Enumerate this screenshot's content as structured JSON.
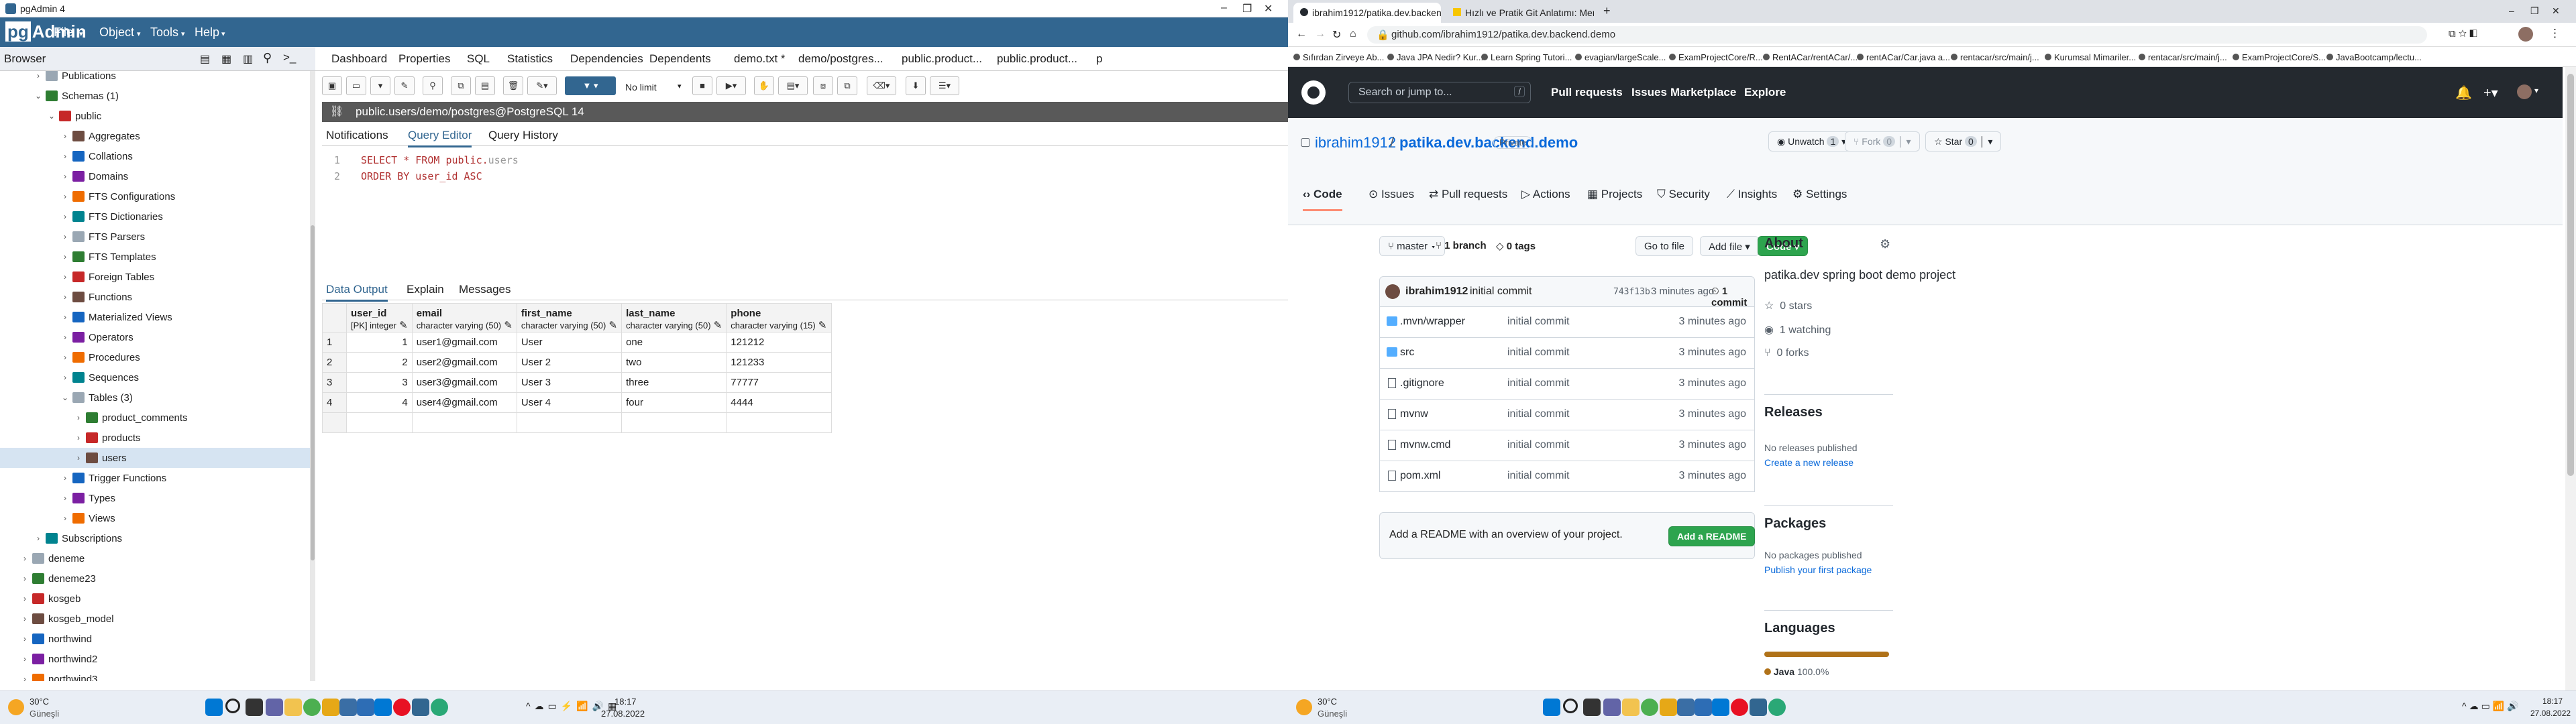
{
  "pgadmin": {
    "title": "pgAdmin 4",
    "menu": [
      "File",
      "Object",
      "Tools",
      "Help"
    ],
    "browser_label": "Browser",
    "tree": [
      {
        "label": "Publications",
        "depth": 3,
        "caret": ">"
      },
      {
        "label": "Schemas (1)",
        "depth": 3,
        "caret": "v"
      },
      {
        "label": "public",
        "depth": 4,
        "caret": "v"
      },
      {
        "label": "Aggregates",
        "depth": 5,
        "caret": ">"
      },
      {
        "label": "Collations",
        "depth": 5,
        "caret": ">"
      },
      {
        "label": "Domains",
        "depth": 5,
        "caret": ">"
      },
      {
        "label": "FTS Configurations",
        "depth": 5,
        "caret": ">"
      },
      {
        "label": "FTS Dictionaries",
        "depth": 5,
        "caret": ">"
      },
      {
        "label": "FTS Parsers",
        "depth": 5,
        "caret": ">"
      },
      {
        "label": "FTS Templates",
        "depth": 5,
        "caret": ">"
      },
      {
        "label": "Foreign Tables",
        "depth": 5,
        "caret": ">"
      },
      {
        "label": "Functions",
        "depth": 5,
        "caret": ">"
      },
      {
        "label": "Materialized Views",
        "depth": 5,
        "caret": ">"
      },
      {
        "label": "Operators",
        "depth": 5,
        "caret": ">"
      },
      {
        "label": "Procedures",
        "depth": 5,
        "caret": ">"
      },
      {
        "label": "Sequences",
        "depth": 5,
        "caret": ">"
      },
      {
        "label": "Tables (3)",
        "depth": 5,
        "caret": "v"
      },
      {
        "label": "product_comments",
        "depth": 6,
        "caret": ">"
      },
      {
        "label": "products",
        "depth": 6,
        "caret": ">"
      },
      {
        "label": "users",
        "depth": 6,
        "caret": ">",
        "selected": true
      },
      {
        "label": "Trigger Functions",
        "depth": 5,
        "caret": ">"
      },
      {
        "label": "Types",
        "depth": 5,
        "caret": ">"
      },
      {
        "label": "Views",
        "depth": 5,
        "caret": ">"
      },
      {
        "label": "Subscriptions",
        "depth": 3,
        "caret": ">"
      },
      {
        "label": "deneme",
        "depth": 2,
        "caret": ">"
      },
      {
        "label": "deneme23",
        "depth": 2,
        "caret": ">"
      },
      {
        "label": "kosgeb",
        "depth": 2,
        "caret": ">"
      },
      {
        "label": "kosgeb_model",
        "depth": 2,
        "caret": ">"
      },
      {
        "label": "northwind",
        "depth": 2,
        "caret": ">"
      },
      {
        "label": "northwind2",
        "depth": 2,
        "caret": ">"
      },
      {
        "label": "northwind3",
        "depth": 2,
        "caret": ">"
      }
    ],
    "tabs": [
      "Dashboard",
      "Properties",
      "SQL",
      "Statistics",
      "Dependencies",
      "Dependents",
      "demo.txt *",
      "demo/postgres...",
      "public.product...",
      "public.product...",
      "p"
    ],
    "limit_label": "No limit",
    "breadcrumb": "public.users/demo/postgres@PostgreSQL 14",
    "editor_tabs": [
      "Notifications",
      "Query Editor",
      "Query History"
    ],
    "sql": {
      "line1_kw": "SELECT * FROM",
      "line1_schema": "public.",
      "line1_table": "users",
      "line2": "ORDER BY user_id ASC"
    },
    "output_tabs": [
      "Data Output",
      "Explain",
      "Messages"
    ],
    "columns": [
      {
        "name": "user_id",
        "type": "[PK] integer"
      },
      {
        "name": "email",
        "type": "character varying (50)"
      },
      {
        "name": "first_name",
        "type": "character varying (50)"
      },
      {
        "name": "last_name",
        "type": "character varying (50)"
      },
      {
        "name": "phone",
        "type": "character varying (15)"
      }
    ],
    "rows": [
      [
        "1",
        "1",
        "user1@gmail.com",
        "User",
        "one",
        "121212"
      ],
      [
        "2",
        "2",
        "user2@gmail.com",
        "User 2",
        "two",
        "121233"
      ],
      [
        "3",
        "3",
        "user3@gmail.com",
        "User 3",
        "three",
        "77777"
      ],
      [
        "4",
        "4",
        "user4@gmail.com",
        "User 4",
        "four",
        "4444"
      ]
    ]
  },
  "taskbar_left": {
    "weather_temp": "30°C",
    "weather_desc": "Güneşli",
    "time": "18:17",
    "date": "27.08.2022"
  },
  "taskbar_right": {
    "weather_temp": "30°C",
    "weather_desc": "Güneşli",
    "time": "18:17",
    "date": "27.08.2022"
  },
  "chrome": {
    "tabs": [
      "ibrahim1912/patika.dev.backend...",
      "Hızlı ve Pratik Git Anlatımı: Merk...",
      "+"
    ],
    "url": "github.com/ibrahim1912/patika.dev.backend.demo",
    "bookmarks": [
      "Sıfırdan Zirveye Ab...",
      "Java JPA Nedir? Kur...",
      "Learn Spring Tutori...",
      "evagian/largeScale...",
      "ExamProjectCore/R...",
      "RentACar/rentACar/...",
      "rentACar/Car.java a...",
      "rentacar/src/main/j...",
      "Kurumsal Mimariler...",
      "rentacar/src/main/j...",
      "ExamProjectCore/S...",
      "JavaBootcamp/lectu..."
    ]
  },
  "github": {
    "search_placeholder": "Search or jump to...",
    "search_key": "/",
    "nav": [
      "Pull requests",
      "Issues",
      "Marketplace",
      "Explore"
    ],
    "owner": "ibrahim1912",
    "repo": "patika.dev.backend.demo",
    "visibility": "Private",
    "unwatch": "Unwatch",
    "watch_count": "1",
    "fork": "Fork",
    "fork_count": "0",
    "star": "Star",
    "star_count": "0",
    "tabs": [
      "Code",
      "Issues",
      "Pull requests",
      "Actions",
      "Projects",
      "Security",
      "Insights",
      "Settings"
    ],
    "branch": "master",
    "branches": "1 branch",
    "tags": "0 tags",
    "go_to_file": "Go to file",
    "add_file": "Add file",
    "code_btn": "Code",
    "commit_author": "ibrahim1912",
    "commit_msg": "initial commit",
    "commit_hash": "743f13b",
    "commit_time": "3 minutes ago",
    "commit_count": "1 commit",
    "files": [
      {
        "name": ".mvn/wrapper",
        "type": "dir",
        "msg": "initial commit",
        "time": "3 minutes ago"
      },
      {
        "name": "src",
        "type": "dir",
        "msg": "initial commit",
        "time": "3 minutes ago"
      },
      {
        "name": ".gitignore",
        "type": "file",
        "msg": "initial commit",
        "time": "3 minutes ago"
      },
      {
        "name": "mvnw",
        "type": "file",
        "msg": "initial commit",
        "time": "3 minutes ago"
      },
      {
        "name": "mvnw.cmd",
        "type": "file",
        "msg": "initial commit",
        "time": "3 minutes ago"
      },
      {
        "name": "pom.xml",
        "type": "file",
        "msg": "initial commit",
        "time": "3 minutes ago"
      }
    ],
    "readme_prompt": "Add a README with an overview of your project.",
    "readme_btn": "Add a README",
    "about_title": "About",
    "about_desc": "patika.dev spring boot demo project",
    "stars": "0 stars",
    "watching": "1 watching",
    "forks": "0 forks",
    "releases_title": "Releases",
    "releases_none": "No releases published",
    "releases_link": "Create a new release",
    "packages_title": "Packages",
    "packages_none": "No packages published",
    "packages_link": "Publish your first package",
    "languages_title": "Languages",
    "language": "Java",
    "language_pct": "100.0%",
    "language_share": 1.0,
    "colors": {
      "java": "#b07219",
      "green": "#2da44e",
      "header": "#24292f"
    }
  }
}
